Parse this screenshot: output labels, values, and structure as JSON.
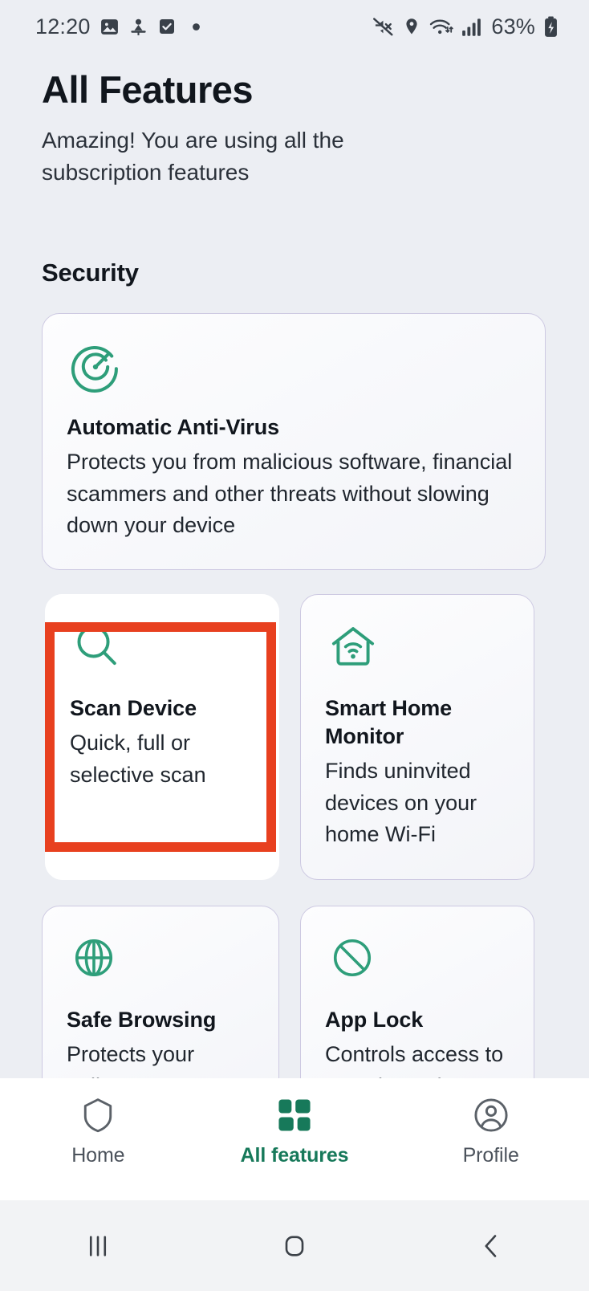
{
  "statusbar": {
    "time": "12:20",
    "battery_percent": "63%",
    "left_icons": [
      "image-icon",
      "person-pin-icon",
      "checkbox-icon",
      "dot-icon"
    ],
    "right_icons": [
      "mute-icon",
      "location-icon",
      "wifi-icon",
      "signal-icon",
      "battery-icon"
    ]
  },
  "header": {
    "title": "All Features",
    "subtitle": "Amazing! You are using all the subscription features"
  },
  "sections": [
    {
      "title": "Security",
      "cards": [
        {
          "id": "antivirus",
          "icon": "scan-target-icon",
          "title": "Automatic Anti-Virus",
          "description": "Protects you from malicious software, financial scammers and other threats without slowing down your device"
        },
        {
          "id": "scan",
          "icon": "magnifier-icon",
          "title": "Scan Device",
          "description": "Quick, full or selective scan",
          "highlighted": true
        },
        {
          "id": "smarthome",
          "icon": "house-wifi-icon",
          "title": "Smart Home Monitor",
          "description": "Finds uninvited devices on your home Wi-Fi"
        },
        {
          "id": "browsing",
          "icon": "globe-icon",
          "title": "Safe Browsing",
          "description": "Protects your online payments"
        },
        {
          "id": "applock",
          "icon": "prohibited-icon",
          "title": "App Lock",
          "description": "Controls access to apps by code"
        }
      ]
    }
  ],
  "tabbar": {
    "tabs": [
      {
        "label": "Home",
        "icon": "shield-icon",
        "active": false
      },
      {
        "label": "All features",
        "icon": "grid-icon",
        "active": true
      },
      {
        "label": "Profile",
        "icon": "account-circle-icon",
        "active": false
      }
    ]
  },
  "navbar": {
    "buttons": [
      {
        "icon": "recents-icon"
      },
      {
        "icon": "home-square-icon"
      },
      {
        "icon": "back-chevron-icon"
      }
    ]
  },
  "colors": {
    "accent_green": "#2e9e7a",
    "active_tab": "#17795a",
    "highlight_red": "#e8401f",
    "page_background": "#eceef3",
    "card_border": "#cdc9e2"
  }
}
